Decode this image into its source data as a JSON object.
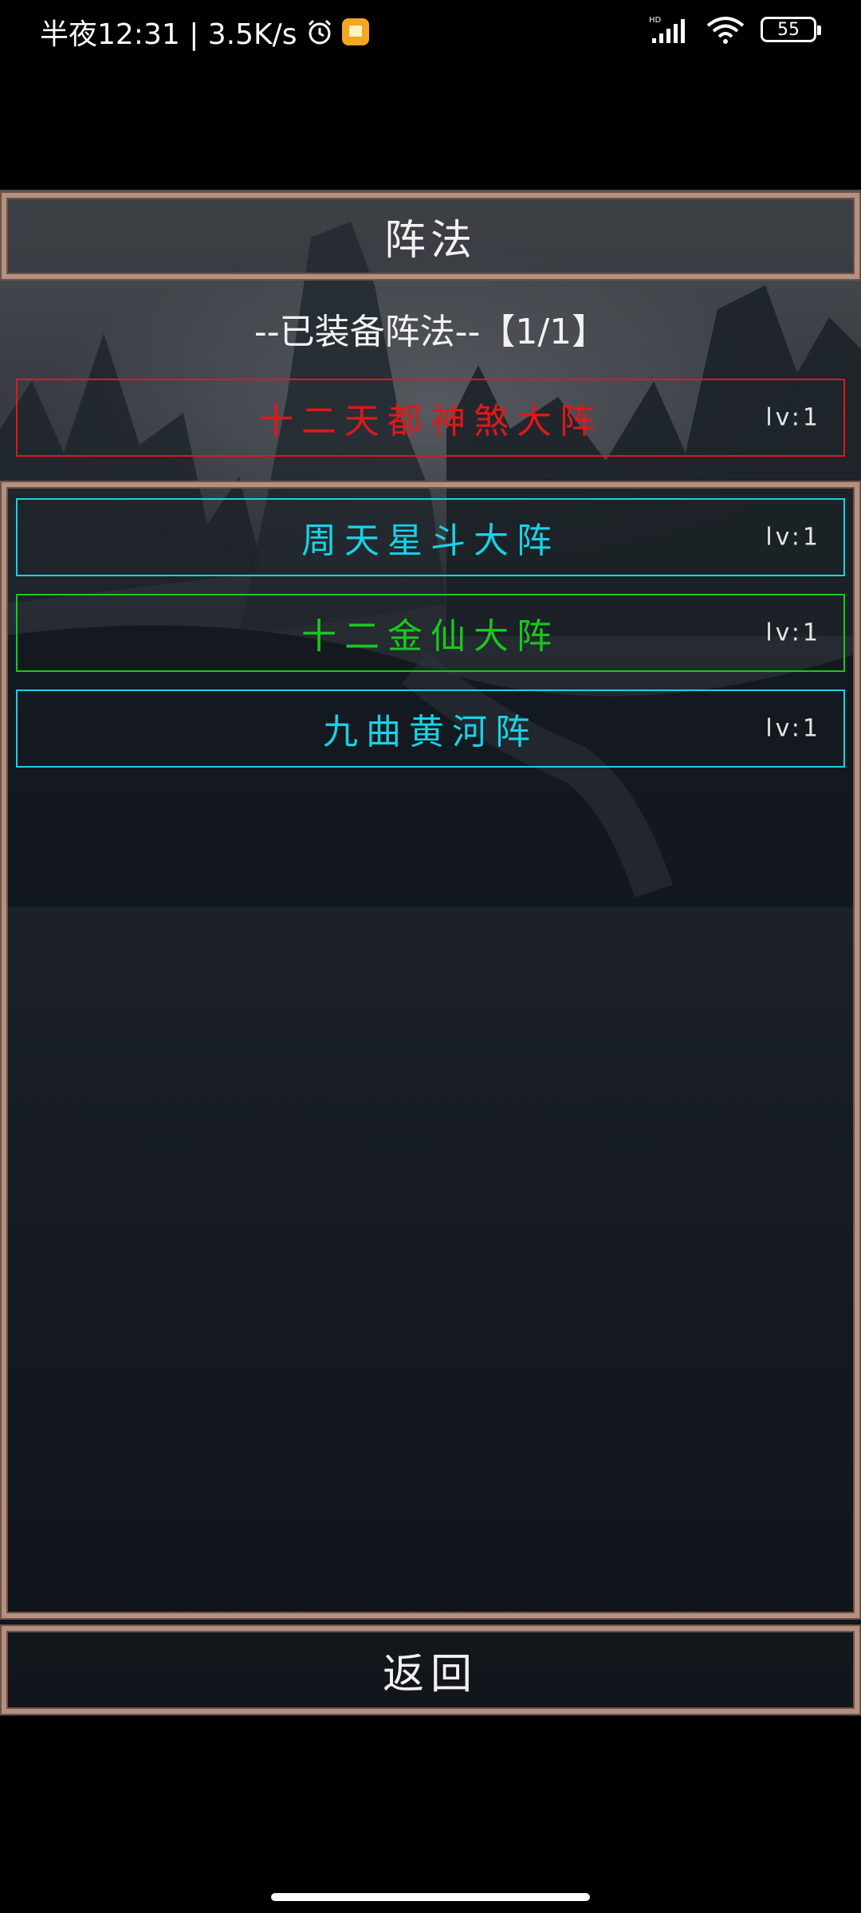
{
  "status_bar": {
    "time_and_speed": "半夜12:31 | 3.5K/s",
    "battery": "55",
    "icons": [
      "alarm-icon",
      "notification-icon",
      "hd-signal-icon",
      "wifi-icon",
      "battery-icon"
    ]
  },
  "title": "阵法",
  "equipped_header": "--已装备阵法--【1/1】",
  "equipped": [
    {
      "name": "十二天都神煞大阵",
      "level": "lv:1",
      "color": "#e01818"
    }
  ],
  "formations": [
    {
      "name": "周天星斗大阵",
      "level": "lv:1",
      "color": "#19d2e6"
    },
    {
      "name": "十二金仙大阵",
      "level": "lv:1",
      "color": "#19c81e"
    },
    {
      "name": "九曲黄河阵",
      "level": "lv:1",
      "color": "#19d2e6"
    }
  ],
  "back_label": "返回",
  "colors": {
    "frame_border": "#b39080",
    "equipped_accent": "#e01818",
    "cyan_accent": "#19d2e6",
    "green_accent": "#19c81e"
  }
}
